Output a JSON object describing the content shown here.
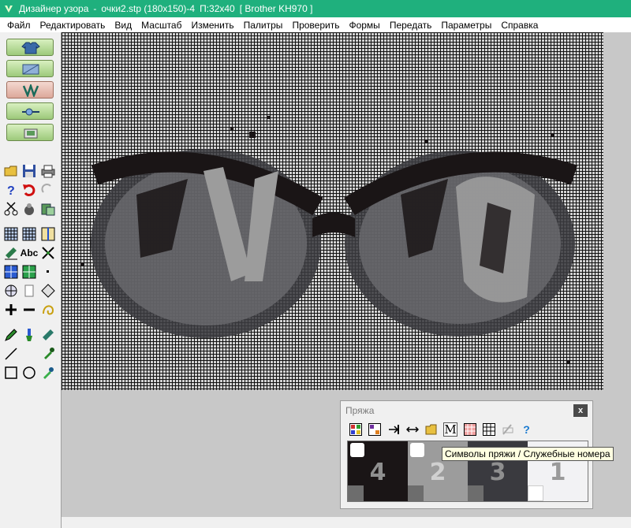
{
  "window": {
    "app_name": "Дизайнер узора",
    "file_name": "очки2.stp (180x150)-4",
    "pitch": "П:32x40",
    "machine": "[ Brother KH970 ]"
  },
  "menu": [
    "Файл",
    "Редактировать",
    "Вид",
    "Масштаб",
    "Изменить",
    "Палитры",
    "Проверить",
    "Формы",
    "Передать",
    "Параметры",
    "Справка"
  ],
  "toolbar_icons": [
    "zoom-in-icon",
    "zoom-out-icon",
    "zoom-fit-icon",
    "zoom-window-icon",
    "ruler-icon",
    "row-marker-icon",
    "grid-icon",
    "rainbow-icon",
    "color-table-icon",
    "palette-icon",
    "color-grid-icon",
    "select-icon",
    "rectangle-icon",
    "select-frame-icon",
    "move-icon",
    "knitwear-front-icon",
    "knitwear-back-icon",
    "knitwear-left-icon",
    "knitwear-right-icon",
    "knitwear-sleeve-icon",
    "check-icon"
  ],
  "left_tools": [
    "sweater-icon",
    "pattern-view-icon",
    "knit-stitch-icon",
    "transfer-icon",
    "printer-preview-icon",
    "open-folder-icon",
    "save-icon",
    "print-icon",
    "help-icon",
    "undo-icon",
    "redo-icon",
    "cut-icon",
    "copy-icon",
    "paste-icon",
    "grid-tool-icon",
    "grid-tool-2-icon",
    "grid-tool-3-icon",
    "eraser-icon",
    "text-icon",
    "shrink-icon",
    "grid-4-icon",
    "grid-5-icon",
    "dot-icon",
    "move-arrows-icon",
    "mirror-icon",
    "shape-icon",
    "plus-icon",
    "minus-icon",
    "pencil-icon",
    "brush-icon",
    "eraser-2-icon",
    "line-icon",
    "fill-icon",
    "eyedropper-icon",
    "rect-tool-icon",
    "circle-tool-icon",
    "dropper-icon"
  ],
  "yarn_panel": {
    "title": "Пряжа",
    "close": "x",
    "toolbar": [
      "palette-icon",
      "color-table-icon",
      "import-icon",
      "swap-icon",
      "open-folder-icon",
      "M",
      "color-grid-icon",
      "grid-icon",
      "disabled-edit-icon",
      "?"
    ],
    "swatches": [
      {
        "number": "4",
        "color": "#1a1516",
        "marker": "#6d6d6d"
      },
      {
        "number": "2",
        "color": "#9c9c9c",
        "marker": "#6d6d6d"
      },
      {
        "number": "3",
        "color": "#3a3a3f",
        "marker": "#6d6d6d"
      },
      {
        "number": "1",
        "color": "#f2f2f4",
        "marker": "#ffffff"
      }
    ]
  },
  "tooltip": "Символы пряжи / Служебные номера",
  "colors": {
    "titlebar": "#1fb07d",
    "canvas_bg": "#c8c8c8",
    "grid_light": "#d2d2d2",
    "grid_dark": "#111111",
    "pattern_dark": "#1a1516",
    "pattern_mid": "#3a3a3f",
    "pattern_grey": "#9c9c9c"
  }
}
